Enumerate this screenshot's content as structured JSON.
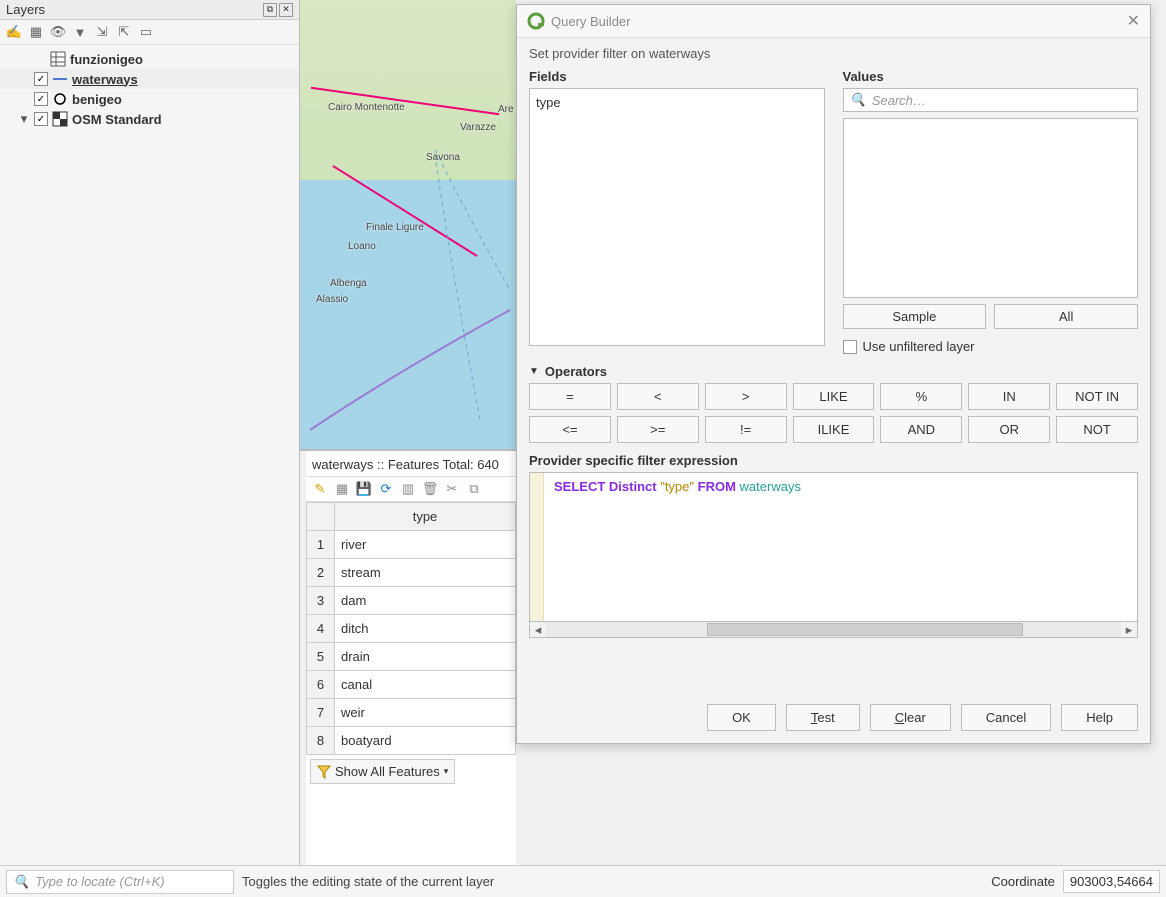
{
  "layers_panel": {
    "title": "Layers",
    "items": [
      {
        "expand": "",
        "checked": false,
        "show_chk": false,
        "icon": "grid",
        "label": "funzionigeo",
        "underline": false
      },
      {
        "expand": "",
        "checked": true,
        "show_chk": true,
        "icon": "line",
        "label": "waterways",
        "underline": true
      },
      {
        "expand": "",
        "checked": true,
        "show_chk": true,
        "icon": "circle",
        "label": "benigeo",
        "underline": false
      },
      {
        "expand": "▾",
        "checked": true,
        "show_chk": true,
        "icon": "checker",
        "label": "OSM Standard",
        "underline": false
      }
    ]
  },
  "map": {
    "labels": [
      "Cairo Montenotte",
      "Varazze",
      "Are",
      "Savona",
      "Finale Ligure",
      "Loano",
      "Albenga",
      "Alassio"
    ]
  },
  "attribute_table": {
    "title": "waterways :: Features Total: 640",
    "column": "type",
    "rows": [
      "river",
      "stream",
      "dam",
      "ditch",
      "drain",
      "canal",
      "weir",
      "boatyard"
    ],
    "show_all": "Show All Features"
  },
  "query_builder": {
    "title": "Query Builder",
    "subtitle": "Set provider filter on waterways",
    "fields_label": "Fields",
    "fields": [
      "type"
    ],
    "values_label": "Values",
    "search_placeholder": "Search…",
    "sample": "Sample",
    "all": "All",
    "unfiltered": "Use unfiltered layer",
    "operators_label": "Operators",
    "operators": [
      "=",
      "<",
      ">",
      "LIKE",
      "%",
      "IN",
      "NOT IN",
      "<=",
      ">=",
      "!=",
      "ILIKE",
      "AND",
      "OR",
      "NOT"
    ],
    "expr_label": "Provider specific filter expression",
    "expression": {
      "kw_select": "SELECT Distinct",
      "field": "\"type\"",
      "kw_from": "FROM",
      "table": "waterways"
    },
    "buttons": {
      "ok": "OK",
      "test": "Test",
      "clear": "Clear",
      "cancel": "Cancel",
      "help": "Help"
    }
  },
  "status": {
    "locate_placeholder": "Type to locate (Ctrl+K)",
    "tip": "Toggles the editing state of the current layer",
    "coord_label": "Coordinate",
    "coord_value": "903003,54664"
  }
}
